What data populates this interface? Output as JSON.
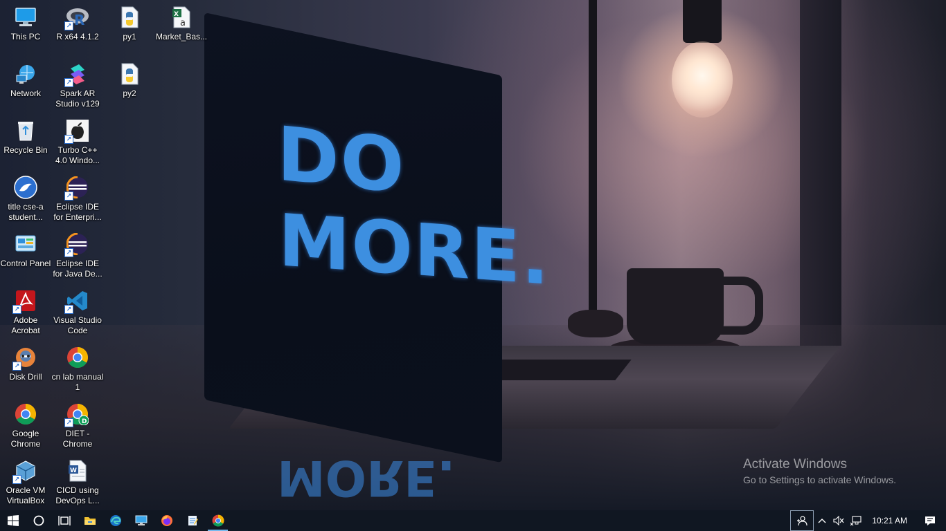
{
  "desktop_icons": [
    {
      "label": "This PC",
      "icon": "this-pc-icon"
    },
    {
      "label": "R x64 4.1.2",
      "icon": "r-language-icon"
    },
    {
      "label": "py1",
      "icon": "python-file-icon"
    },
    {
      "label": "Market_Bas...",
      "icon": "excel-file-icon"
    },
    {
      "label": "Network",
      "icon": "network-icon"
    },
    {
      "label": "Spark AR Studio v129",
      "icon": "spark-ar-icon"
    },
    {
      "label": "py2",
      "icon": "python-file-icon"
    },
    {
      "label": "Recycle Bin",
      "icon": "recycle-bin-icon"
    },
    {
      "label": "Turbo C++ 4.0 Windo...",
      "icon": "turbo-cpp-icon"
    },
    {
      "label": "title cse-a student...",
      "icon": "bird-app-icon"
    },
    {
      "label": "Eclipse IDE for Enterpri...",
      "icon": "eclipse-icon"
    },
    {
      "label": "Control Panel",
      "icon": "control-panel-icon"
    },
    {
      "label": "Eclipse IDE for Java De...",
      "icon": "eclipse-icon"
    },
    {
      "label": "Adobe Acrobat",
      "icon": "adobe-acrobat-icon"
    },
    {
      "label": "Visual Studio Code",
      "icon": "vscode-icon"
    },
    {
      "label": "Disk Drill",
      "icon": "disk-drill-icon"
    },
    {
      "label": "cn lab manual 1",
      "icon": "chrome-icon"
    },
    {
      "label": "Google Chrome",
      "icon": "chrome-icon"
    },
    {
      "label": "DIET - Chrome",
      "icon": "chrome-profile-icon"
    },
    {
      "label": "Oracle VM VirtualBox",
      "icon": "virtualbox-icon"
    },
    {
      "label": "CICD using DevOps L...",
      "icon": "word-file-icon"
    }
  ],
  "wallpaper": {
    "slogan_line1": "DO",
    "slogan_line2": "MORE."
  },
  "watermark": {
    "title": "Activate Windows",
    "subtitle": "Go to Settings to activate Windows."
  },
  "taskbar": {
    "pinned": [
      {
        "name": "start-button",
        "icon": "windows-logo-icon"
      },
      {
        "name": "search-button",
        "icon": "cortana-circle-icon"
      },
      {
        "name": "task-view-button",
        "icon": "task-view-icon"
      },
      {
        "name": "file-explorer-button",
        "icon": "folder-icon"
      },
      {
        "name": "edge-button",
        "icon": "edge-icon"
      },
      {
        "name": "remote-desktop-button",
        "icon": "monitor-icon"
      },
      {
        "name": "firefox-button",
        "icon": "firefox-icon"
      },
      {
        "name": "notepad-button",
        "icon": "notepad-icon"
      },
      {
        "name": "chrome-button",
        "icon": "chrome-icon"
      }
    ],
    "clock": "10:21 AM"
  },
  "colors": {
    "taskbar": "#101722",
    "accent": "#76b9ed",
    "slogan": "#3d8fe0"
  }
}
